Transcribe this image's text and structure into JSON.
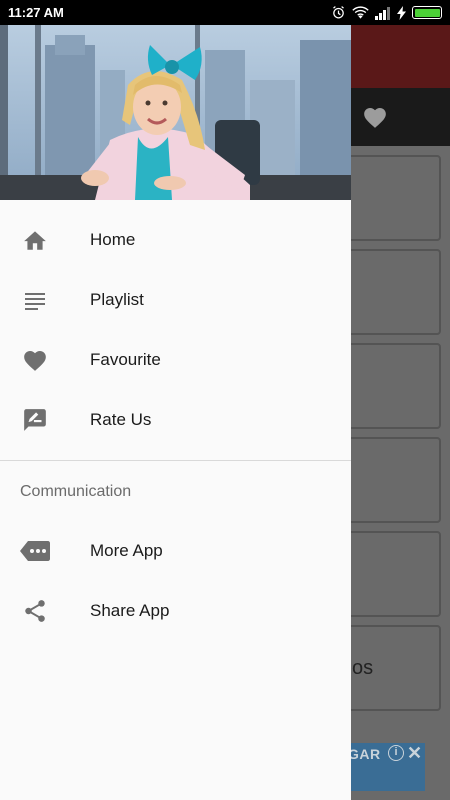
{
  "status_bar": {
    "time": "11:27 AM",
    "icons": [
      "alarm-icon",
      "wifi-icon",
      "signal-icon",
      "charging-icon",
      "battery-icon"
    ],
    "battery_level": 1.0
  },
  "background_app": {
    "toolbar_color": "#5a1818",
    "card_partial_text": "os",
    "ad": {
      "partial_text": "GAR",
      "info_label": "i",
      "close_label": "✕"
    }
  },
  "drawer": {
    "header_image": "girl-with-bow-photo",
    "menu_items": [
      {
        "label": "Home",
        "icon": "home-icon"
      },
      {
        "label": "Playlist",
        "icon": "playlist-icon"
      },
      {
        "label": "Favourite",
        "icon": "heart-icon"
      },
      {
        "label": "Rate Us",
        "icon": "rate-review-icon"
      }
    ],
    "section_title": "Communication",
    "section_items": [
      {
        "label": "More App",
        "icon": "more-apps-icon"
      },
      {
        "label": "Share App",
        "icon": "share-icon"
      }
    ]
  },
  "colors": {
    "icon": "#6f6f6f",
    "text": "#1b1b1b",
    "battery": "#4cd137"
  }
}
